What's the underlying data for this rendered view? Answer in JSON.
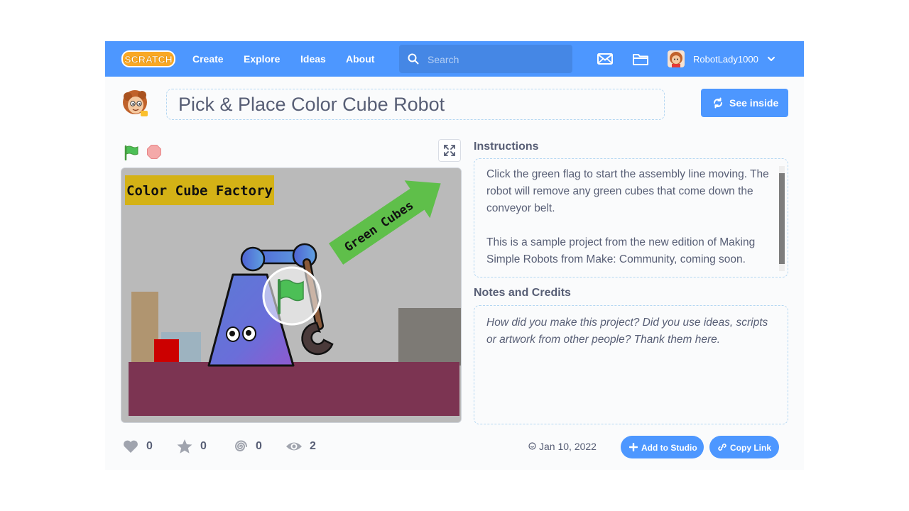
{
  "nav": {
    "logo_text": "SCRATCH",
    "links": [
      "Create",
      "Explore",
      "Ideas",
      "About"
    ],
    "search_placeholder": "Search",
    "username": "RobotLady1000"
  },
  "project": {
    "title": "Pick & Place Color Cube Robot",
    "see_inside_label": "See inside"
  },
  "stage": {
    "sign_text": "Color Cube Factory",
    "arrow_text": "Green Cubes"
  },
  "instructions": {
    "heading": "Instructions",
    "text": "Click the green flag to start the assembly line moving. The robot will remove any green cubes that come down the conveyor belt.\n\nThis is a sample project from the new edition of Making Simple Robots from Make: Community, coming soon."
  },
  "notes": {
    "heading": "Notes and Credits",
    "placeholder": "How did you make this project? Did you use ideas, scripts or artwork from other people? Thank them here."
  },
  "stats": {
    "loves": "0",
    "favorites": "0",
    "remixes": "0",
    "views": "2"
  },
  "date": "Jan 10, 2022",
  "buttons": {
    "add_to_studio": "Add to Studio",
    "copy_link": "Copy Link"
  },
  "colors": {
    "accent": "#4d97ff",
    "green_flag": "#4cbf56",
    "text": "#575e75"
  }
}
